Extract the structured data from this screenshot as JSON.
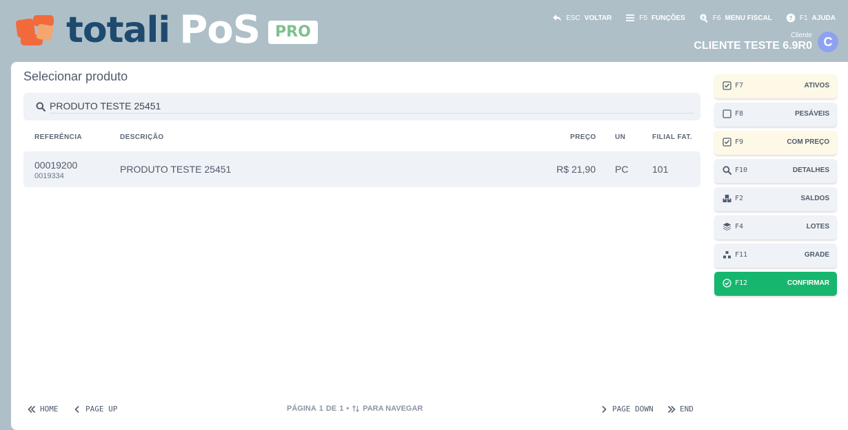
{
  "brand": {
    "word": "totali",
    "product": "PoS",
    "edition": "PRO",
    "mark_colors": [
      "#f26a3c",
      "#f3a66f"
    ]
  },
  "topnav": [
    {
      "key": "ESC",
      "label": "VOLTAR",
      "icon": "back-arrow-icon"
    },
    {
      "key": "F5",
      "label": "FUNÇÕES",
      "icon": "menu-icon"
    },
    {
      "key": "F6",
      "label": "MENU FISCAL",
      "icon": "search-dollar-icon"
    },
    {
      "key": "F1",
      "label": "AJUDA",
      "icon": "help-icon"
    }
  ],
  "client": {
    "caption": "Cliente",
    "name": "CLIENTE TESTE 6.9R0",
    "avatar": "C"
  },
  "main": {
    "title": "Selecionar produto",
    "search": {
      "value": "PRODUTO TESTE 25451",
      "placeholder": ""
    },
    "columns": [
      "REFERÊNCIA",
      "DESCRIÇÃO",
      "PREÇO",
      "UN",
      "FILIAL FAT."
    ],
    "rows": [
      {
        "ref": "00019200",
        "ref_sub": "0019334",
        "desc": "PRODUTO TESTE 25451",
        "price": "R$ 21,90",
        "un": "PC",
        "filial": "101"
      }
    ],
    "footer": {
      "home": "HOME",
      "page_up": "PAGE UP",
      "page_down": "PAGE DOWN",
      "end": "END",
      "page_label": "PÁGINA",
      "page_current": "1",
      "page_of": "DE",
      "page_total": "1",
      "nav_hint": "PARA NAVEGAR"
    }
  },
  "side_buttons": [
    {
      "key": "F7",
      "label": "ATIVOS",
      "icon": "checkbox-checked-icon",
      "style": "yellow"
    },
    {
      "key": "F8",
      "label": "PESÁVEIS",
      "icon": "checkbox-empty-icon",
      "style": "plain"
    },
    {
      "key": "F9",
      "label": "COM PREÇO",
      "icon": "checkbox-checked-icon",
      "style": "yellow"
    },
    {
      "key": "F10",
      "label": "DETALHES",
      "icon": "search-icon",
      "style": "plain"
    },
    {
      "key": "F2",
      "label": "SALDOS",
      "icon": "boxes-icon",
      "style": "plain"
    },
    {
      "key": "F4",
      "label": "LOTES",
      "icon": "layers-icon",
      "style": "plain"
    },
    {
      "key": "F11",
      "label": "GRADE",
      "icon": "grid-icon",
      "style": "plain"
    },
    {
      "key": "F12",
      "label": "CONFIRMAR",
      "icon": "check-circle-icon",
      "style": "green"
    }
  ],
  "colors": {
    "header_bg": "#aebfc8",
    "accent_green": "#17b66f",
    "highlight_yellow": "#fdf9e6",
    "avatar": "#8fa2f0"
  }
}
